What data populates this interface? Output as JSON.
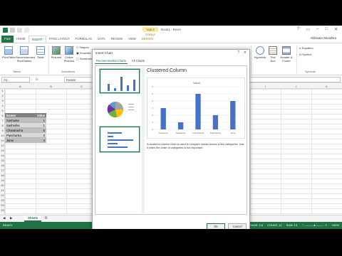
{
  "window": {
    "context_tab": "TABLE TOOLS",
    "title": "Book1 - Excel",
    "user": "Abhisam Mundhra"
  },
  "tabs": [
    "FILE",
    "HOME",
    "INSERT",
    "PAGE LAYOUT",
    "FORMULAS",
    "DATA",
    "REVIEW",
    "VIEW",
    "DESIGN"
  ],
  "active_tab": "INSERT",
  "ribbon": {
    "pivot": "PivotTable",
    "recommended_pivot": "Recommended PivotTables",
    "table": "Table",
    "pictures": "Pictures",
    "online_pictures": "Online Pictures",
    "shapes": "Shapes",
    "smartart": "SmartArt",
    "screenshot": "Screenshot",
    "tables_group": "Tables",
    "illustrations_group": "Illustrations",
    "hyperlink": "Hyperlink",
    "text_box": "Text Box",
    "header_footer": "Header & Footer",
    "equation": "Equation",
    "symbol": "Symbol",
    "symbols_group": "Symbols"
  },
  "formula_bar": {
    "name_box": "A1",
    "fx": "fx",
    "value": "Kumar"
  },
  "columns": [
    "A",
    "B",
    "C",
    "D",
    "E",
    "F",
    "G",
    "H",
    "I",
    "J",
    "K"
  ],
  "rows": [
    "1",
    "2",
    "3",
    "4",
    "5",
    "6",
    "7",
    "8",
    "9",
    "10",
    "11",
    "12",
    "13",
    "14",
    "15",
    "16",
    "17",
    "18",
    "19",
    "20",
    "21",
    "22",
    "23",
    "24",
    "25"
  ],
  "table": {
    "headers": [
      "Kumar",
      "Value"
    ],
    "rows": [
      [
        "Sushanta",
        "1"
      ],
      [
        "Sasharika",
        "1"
      ],
      [
        "Chandranha",
        "5"
      ],
      [
        "Paachanka",
        "2"
      ],
      [
        "Jame",
        "4"
      ]
    ]
  },
  "sheet_tab": "Sheet1",
  "status": {
    "left": "READY",
    "average": "AVERAGE: 2.6",
    "count": "COUNT: 12",
    "sum": "SUM: 13",
    "zoom": "100%"
  },
  "dialog": {
    "title": "Insert Chart",
    "help": "?",
    "close": "✕",
    "tabs": [
      "Recommended Charts",
      "All Charts"
    ],
    "preview_title": "Clustered Column",
    "description": "A clustered column chart is used to compare values across a few categories. Use it when the order of categories is not important.",
    "ok": "OK",
    "cancel": "Cancel"
  },
  "chart_data": {
    "type": "bar",
    "title": "Value",
    "categories": [
      "Sushanta",
      "Sasharika",
      "Chandranha",
      "Paachanka",
      "Jame"
    ],
    "values": [
      3,
      1,
      5,
      2,
      4
    ],
    "ylim": [
      0,
      6
    ],
    "yticks": [
      0,
      1,
      2,
      3,
      4,
      5,
      6
    ],
    "bar_color": "#4472c4"
  }
}
